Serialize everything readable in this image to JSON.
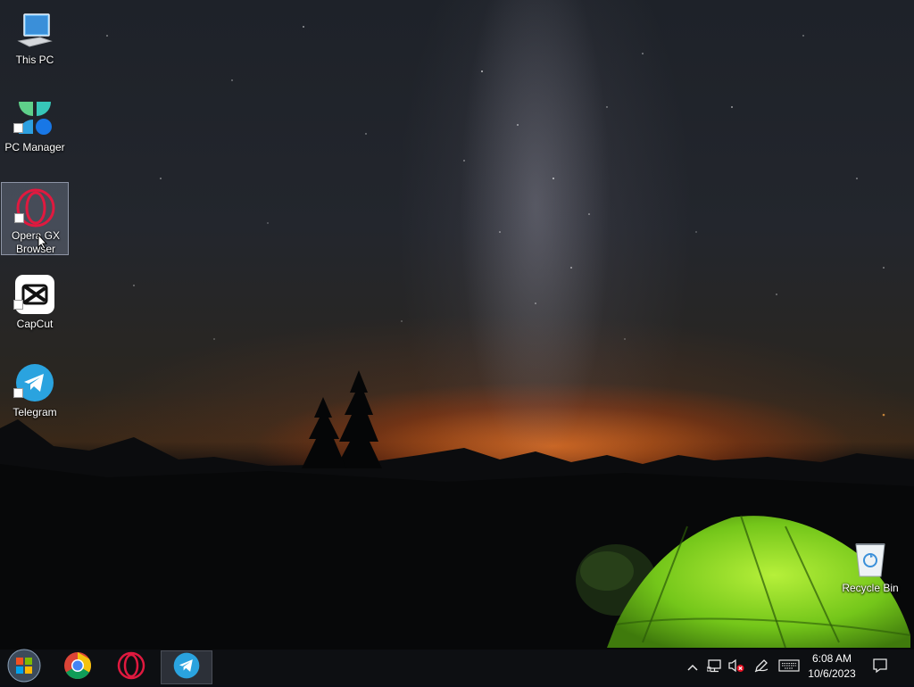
{
  "desktop": {
    "icons": [
      {
        "label": "This PC",
        "icon": "this-pc-icon"
      },
      {
        "label": "PC Manager",
        "icon": "pc-manager-icon"
      },
      {
        "label": "Opera GX Browser",
        "icon": "opera-gx-icon",
        "selected": true
      },
      {
        "label": "CapCut",
        "icon": "capcut-icon"
      },
      {
        "label": "Telegram",
        "icon": "telegram-icon"
      },
      {
        "label": "Recycle Bin",
        "icon": "recycle-bin-icon"
      }
    ]
  },
  "taskbar": {
    "apps": [
      {
        "icon": "windows-start-icon"
      },
      {
        "icon": "chrome-icon"
      },
      {
        "icon": "opera-icon"
      },
      {
        "icon": "telegram-icon",
        "active": true
      }
    ],
    "tray": {
      "icons": [
        "chevron-up-icon",
        "network-icon",
        "volume-muted-icon",
        "pen-icon",
        "keyboard-icon",
        "notification-icon"
      ]
    },
    "clock": {
      "time": "6:08 AM",
      "date": "10/6/2023"
    }
  },
  "colors": {
    "opera_red": "#e0193f",
    "telegram_blue": "#2aa3df",
    "tent_green": "#7bd11e",
    "taskbar": "#0d0f12"
  }
}
